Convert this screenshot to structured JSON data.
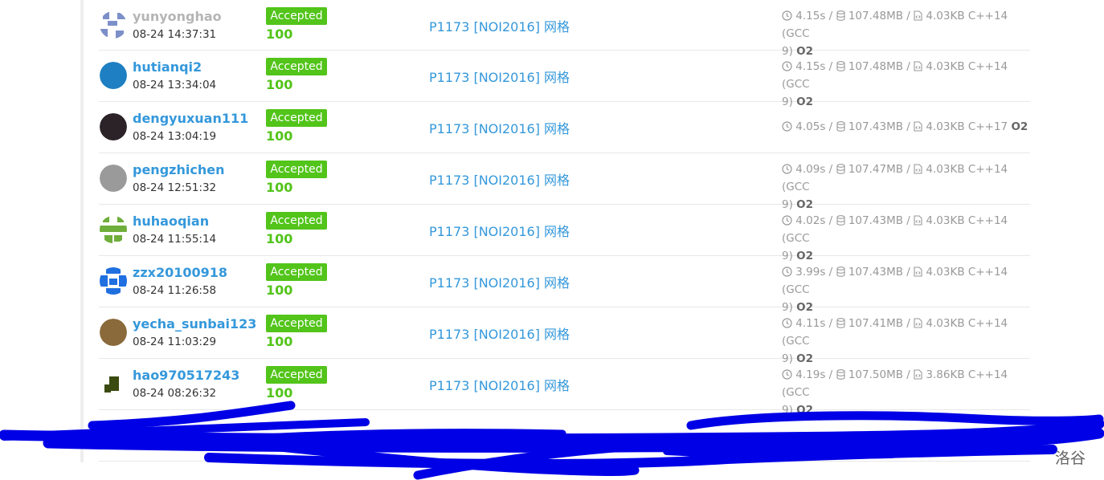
{
  "records": [
    {
      "user": "yunyonghao",
      "time": "08-24 14:37:31",
      "status": "Accepted",
      "score": "100",
      "problem": "P1173 [NOI2016] 网格",
      "time_used": "4.15s",
      "memory": "107.48MB",
      "code_size": "4.03KB",
      "lang_a": "C++14 (GCC",
      "lang_b": "9)",
      "opt": "O2",
      "avatar_color": "#7d8fc9",
      "name_color": "gray"
    },
    {
      "user": "hutianqi2",
      "time": "08-24 13:34:04",
      "status": "Accepted",
      "score": "100",
      "problem": "P1173 [NOI2016] 网格",
      "time_used": "4.15s",
      "memory": "107.48MB",
      "code_size": "4.03KB",
      "lang_a": "C++14 (GCC",
      "lang_b": "9)",
      "opt": "O2",
      "avatar_color": "#1e7fc2",
      "name_color": "blue"
    },
    {
      "user": "dengyuxuan111",
      "time": "08-24 13:04:19",
      "status": "Accepted",
      "score": "100",
      "problem": "P1173 [NOI2016] 网格",
      "time_used": "4.05s",
      "memory": "107.43MB",
      "code_size": "4.03KB",
      "lang_a": "C++17",
      "lang_b": "",
      "opt": "O2",
      "avatar_color": "#2b2327",
      "name_color": "blue"
    },
    {
      "user": "pengzhichen",
      "time": "08-24 12:51:32",
      "status": "Accepted",
      "score": "100",
      "problem": "P1173 [NOI2016] 网格",
      "time_used": "4.09s",
      "memory": "107.47MB",
      "code_size": "4.03KB",
      "lang_a": "C++14 (GCC",
      "lang_b": "9)",
      "opt": "O2",
      "avatar_color": "#9a9a9a",
      "name_color": "blue"
    },
    {
      "user": "huhaoqian",
      "time": "08-24 11:55:14",
      "status": "Accepted",
      "score": "100",
      "problem": "P1173 [NOI2016] 网格",
      "time_used": "4.02s",
      "memory": "107.43MB",
      "code_size": "4.03KB",
      "lang_a": "C++14 (GCC",
      "lang_b": "9)",
      "opt": "O2",
      "avatar_color": "#6fae3a",
      "name_color": "blue"
    },
    {
      "user": "zzx20100918",
      "time": "08-24 11:26:58",
      "status": "Accepted",
      "score": "100",
      "problem": "P1173 [NOI2016] 网格",
      "time_used": "3.99s",
      "memory": "107.43MB",
      "code_size": "4.03KB",
      "lang_a": "C++14 (GCC",
      "lang_b": "9)",
      "opt": "O2",
      "avatar_color": "#1f6fe0",
      "name_color": "blue"
    },
    {
      "user": "yecha_sunbai123",
      "time": "08-24 11:03:29",
      "status": "Accepted",
      "score": "100",
      "problem": "P1173 [NOI2016] 网格",
      "time_used": "4.11s",
      "memory": "107.41MB",
      "code_size": "4.03KB",
      "lang_a": "C++14 (GCC",
      "lang_b": "9)",
      "opt": "O2",
      "avatar_color": "#8a6a3a",
      "name_color": "blue"
    },
    {
      "user": "hao970517243",
      "time": "08-24 08:26:32",
      "status": "Accepted",
      "score": "100",
      "problem": "P1173 [NOI2016] 网格",
      "time_used": "4.19s",
      "memory": "107.50MB",
      "code_size": "3.86KB",
      "lang_a": "C++14 (GCC",
      "lang_b": "9)",
      "opt": "O2",
      "avatar_color": "#3a4a10",
      "name_color": "blue"
    },
    {
      "user": "",
      "time": "",
      "status": "",
      "score": "",
      "problem": "",
      "time_used": "",
      "memory": "",
      "code_size": "",
      "lang_a": "",
      "lang_b": "",
      "opt": "",
      "avatar_color": "#cccccc",
      "name_color": "blue"
    }
  ],
  "separator": "/",
  "watermark": "洛谷",
  "scribble_color": "#0000e6"
}
